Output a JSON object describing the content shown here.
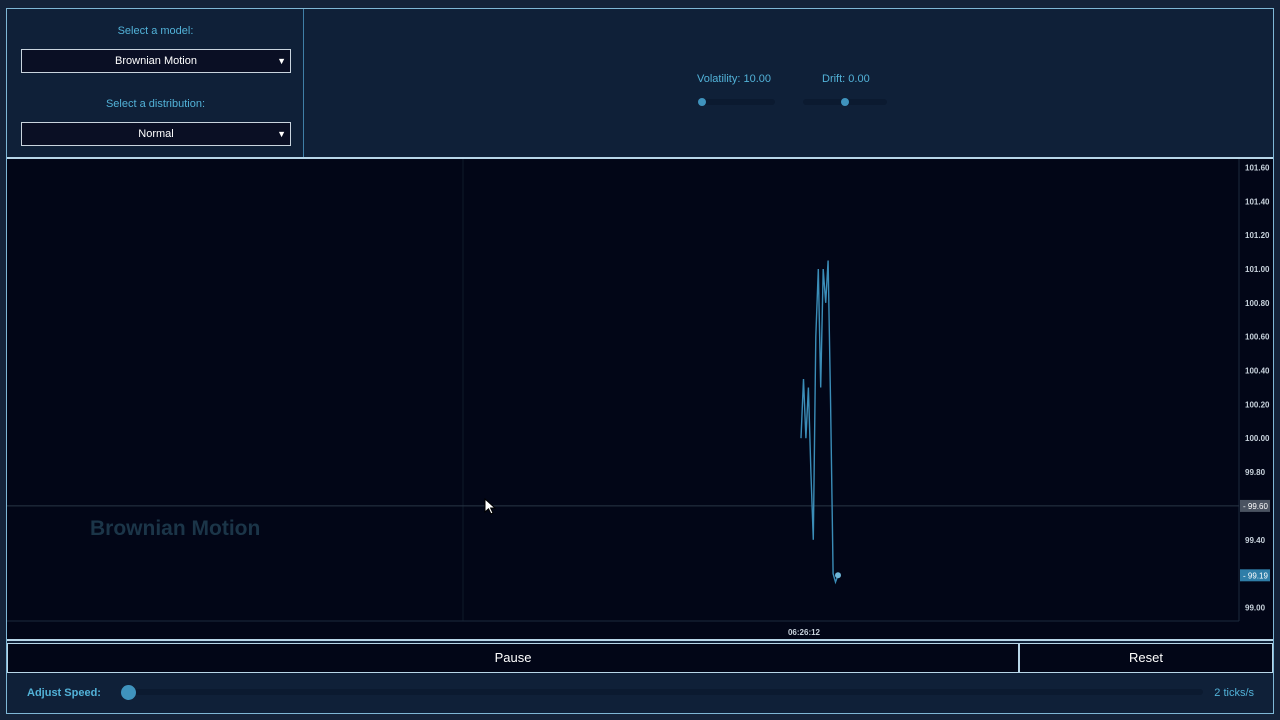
{
  "controls": {
    "model_label": "Select a model:",
    "model_value": "Brownian Motion",
    "distribution_label": "Select a distribution:",
    "distribution_value": "Normal",
    "volatility_label": "Volatility: 10.00",
    "drift_label": "Drift: 0.00",
    "volatility_fraction": 0.0,
    "drift_fraction": 0.5
  },
  "chart": {
    "watermark": "Brownian Motion",
    "x_tick": "06:26:12",
    "crosshair_label": "99.60",
    "last_value_label": "99.19",
    "line_color": "#3b8db8"
  },
  "actions": {
    "pause_label": "Pause",
    "reset_label": "Reset"
  },
  "speed": {
    "label": "Adjust Speed:",
    "value_text": "2 ticks/s",
    "fraction": 0.0
  },
  "chart_data": {
    "type": "line",
    "y_ticks": [
      "101.60",
      "101.40",
      "101.20",
      "101.00",
      "100.80",
      "100.60",
      "100.40",
      "100.20",
      "100.00",
      "99.80",
      "99.60",
      "99.40",
      "99.20",
      "99.00"
    ],
    "ylim": [
      98.92,
      101.65
    ],
    "crosshair_y": 99.6,
    "last_value": 99.19,
    "series": [
      {
        "values": [
          100.0,
          100.35,
          100.0,
          100.3,
          99.8,
          99.4,
          100.6,
          101.0,
          100.3,
          101.0,
          100.8,
          101.05,
          100.2,
          99.2,
          99.15,
          99.19
        ]
      }
    ]
  }
}
